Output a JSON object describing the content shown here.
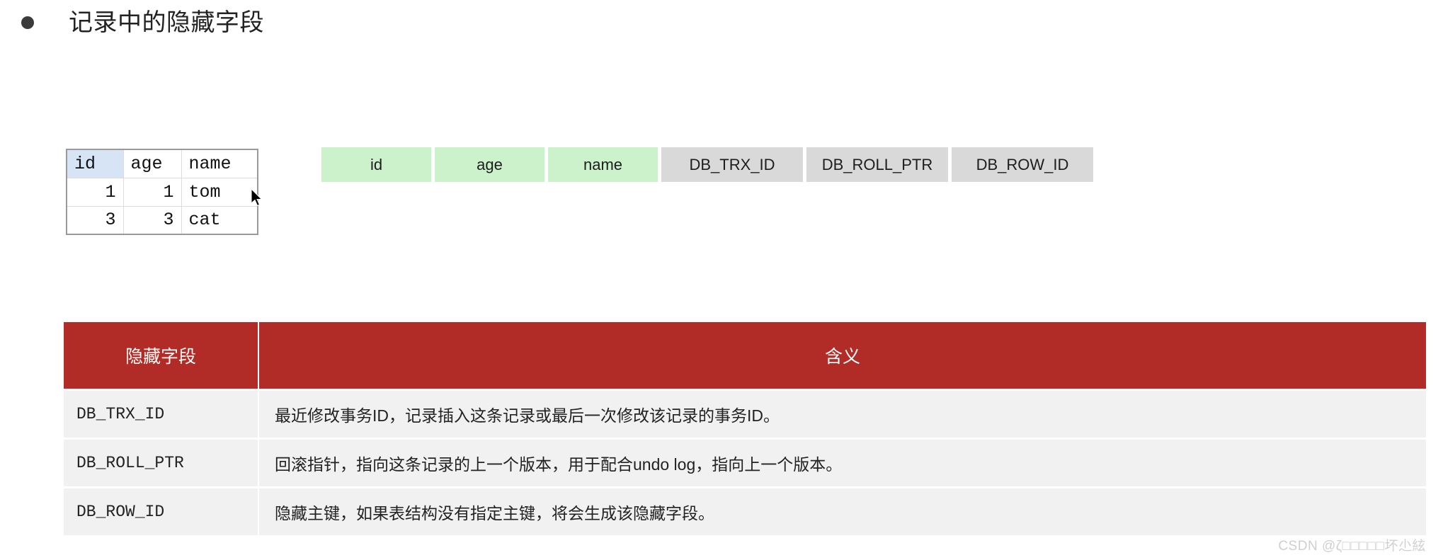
{
  "slide": {
    "bullet_icon": "bullet-dot-icon",
    "title": "记录中的隐藏字段"
  },
  "record_grid": {
    "columns": [
      "id",
      "age",
      "name"
    ],
    "rows": [
      {
        "id": "1",
        "age": "1",
        "name": "tom"
      },
      {
        "id": "3",
        "age": "3",
        "name": "cat"
      }
    ],
    "selected_column": "id",
    "selected_header_color": "#d6e4f5"
  },
  "cursor": {
    "icon": "mouse-pointer-icon"
  },
  "field_strip": {
    "visible_color": "#ccf2cc",
    "hidden_color": "#d9d9d9",
    "visible_fields": [
      "id",
      "age",
      "name"
    ],
    "hidden_fields": [
      "DB_TRX_ID",
      "DB_ROLL_PTR",
      "DB_ROW_ID"
    ]
  },
  "meaning_table": {
    "header_color": "#b22c27",
    "row_color": "#f1f1f1",
    "headers": {
      "field": "隐藏字段",
      "meaning": "含义"
    },
    "rows": [
      {
        "field": "DB_TRX_ID",
        "meaning": "最近修改事务ID，记录插入这条记录或最后一次修改该记录的事务ID。"
      },
      {
        "field": "DB_ROLL_PTR",
        "meaning": "回滚指针，指向这条记录的上一个版本，用于配合undo log，指向上一个版本。"
      },
      {
        "field": "DB_ROW_ID",
        "meaning": "隐藏主键，如果表结构没有指定主键，将会生成该隐藏字段。"
      }
    ]
  },
  "watermark": {
    "text": "CSDN @ζ□□□□□坏尐絃"
  }
}
